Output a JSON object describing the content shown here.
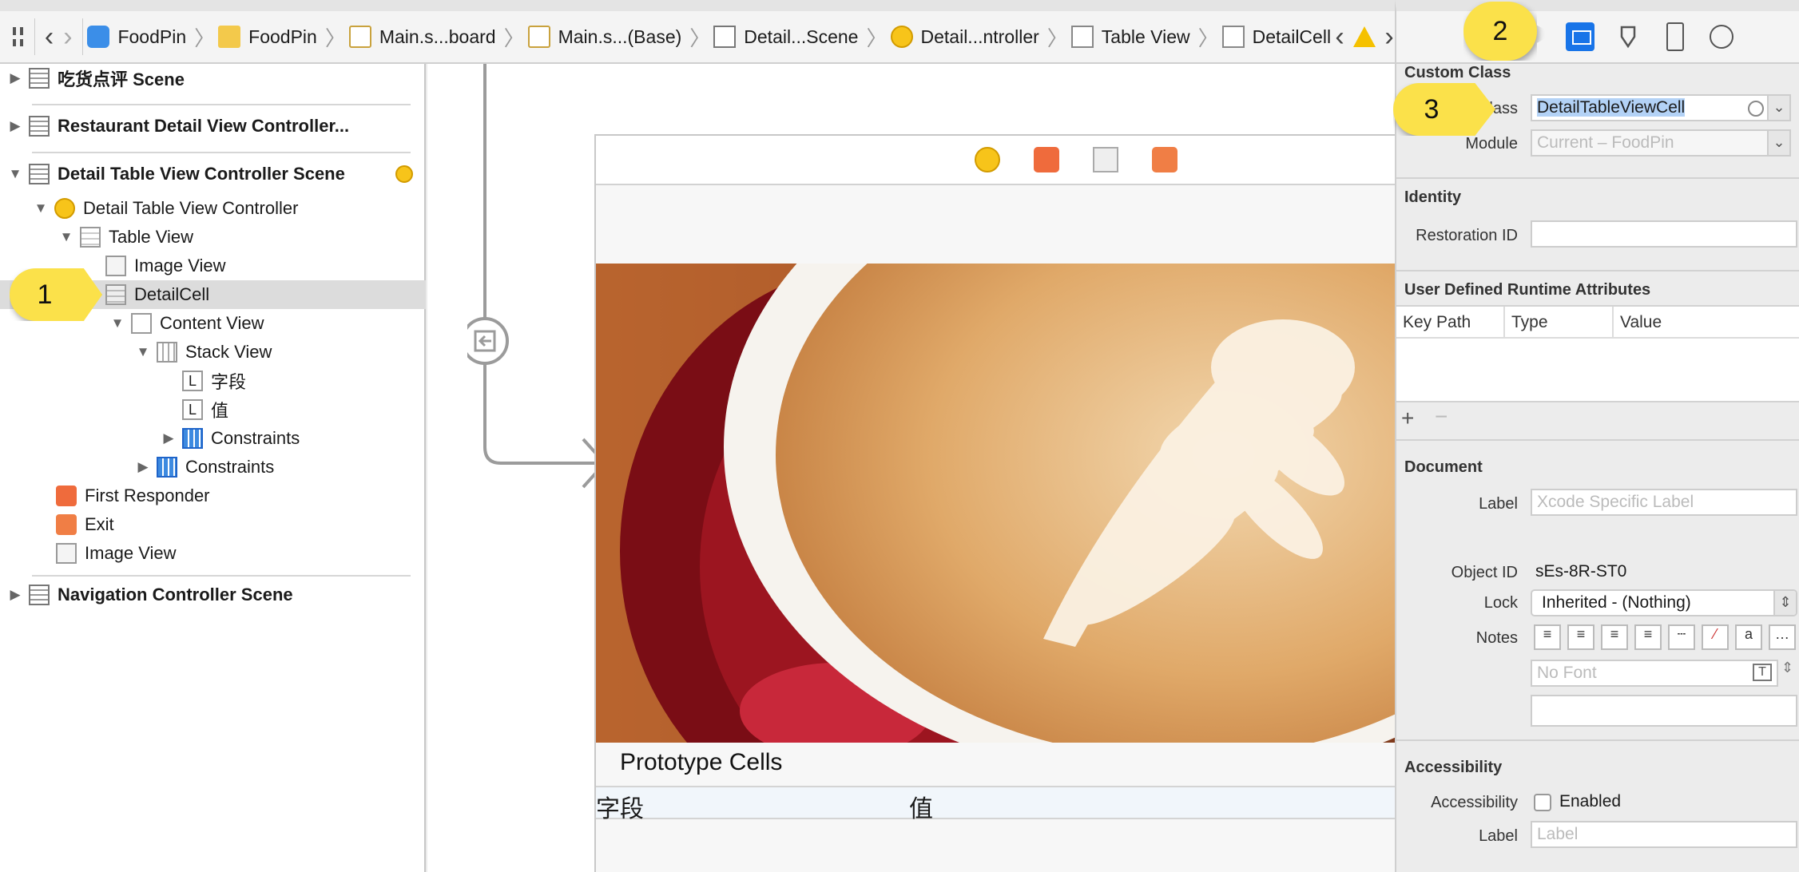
{
  "jumpbar": {
    "crumbs": [
      "FoodPin",
      "FoodPin",
      "Main.s...board",
      "Main.s...(Base)",
      "Detail...Scene",
      "Detail...ntroller",
      "Table View",
      "DetailCell"
    ]
  },
  "outline": {
    "scene1": "吃货点评 Scene",
    "scene2": "Restaurant Detail View Controller...",
    "scene3": "Detail Table View Controller Scene",
    "vc": "Detail Table View Controller",
    "tableview": "Table View",
    "imageview": "Image View",
    "detailcell": "DetailCell",
    "contentview": "Content View",
    "stackview": "Stack View",
    "label1": "字段",
    "label2": "值",
    "label_glyph": "L",
    "constraints_inner": "Constraints",
    "constraints_outer": "Constraints",
    "first_responder": "First Responder",
    "exit": "Exit",
    "imageview2": "Image View",
    "scene4": "Navigation Controller Scene"
  },
  "canvas": {
    "prototype_cells": "Prototype Cells",
    "cell_field": "字段",
    "cell_value": "值"
  },
  "inspector": {
    "custom_class": {
      "title": "Custom Class",
      "class_label": "Class",
      "class_value": "DetailTableViewCell",
      "module_label": "Module",
      "module_placeholder": "Current – FoodPin"
    },
    "identity": {
      "title": "Identity",
      "restoration_label": "Restoration ID"
    },
    "runtime": {
      "title": "User Defined Runtime Attributes",
      "col_keypath": "Key Path",
      "col_type": "Type",
      "col_value": "Value"
    },
    "document": {
      "title": "Document",
      "label_label": "Label",
      "label_placeholder": "Xcode Specific Label",
      "objectid_label": "Object ID",
      "objectid_value": "sEs-8R-ST0",
      "lock_label": "Lock",
      "lock_value": "Inherited - (Nothing)",
      "notes_label": "Notes",
      "font_placeholder": "No Font"
    },
    "accessibility": {
      "title": "Accessibility",
      "acc_label": "Accessibility",
      "enabled": "Enabled",
      "label_label": "Label",
      "label_placeholder": "Label"
    },
    "swatch_colors": [
      "#f27d7d",
      "#f5b26b",
      "#f3e06a",
      "#b6dc73",
      "#7fbcef",
      "#c9a7e6",
      "#c8c8c8"
    ]
  },
  "callouts": {
    "one": "1",
    "two": "2",
    "three": "3"
  }
}
